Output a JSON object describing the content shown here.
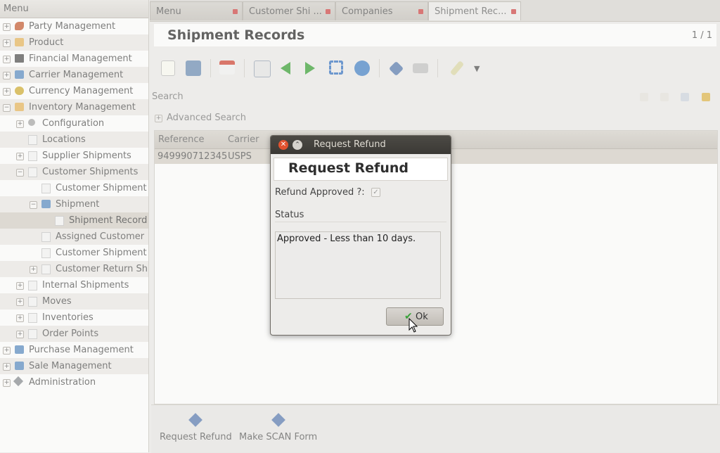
{
  "sidebar": {
    "header": "Menu",
    "items": [
      {
        "label": "Party Management",
        "expander": "+",
        "icon": "party-icon"
      },
      {
        "label": "Product",
        "expander": "+",
        "icon": "box-icon"
      },
      {
        "label": "Financial Management",
        "expander": "+",
        "icon": "calculator-icon"
      },
      {
        "label": "Carrier Management",
        "expander": "+",
        "icon": "folder-icon"
      },
      {
        "label": "Currency Management",
        "expander": "+",
        "icon": "coins-icon"
      },
      {
        "label": "Inventory Management",
        "expander": "−",
        "icon": "box-icon"
      },
      {
        "label": "Configuration",
        "expander": "+",
        "icon": "gear-icon"
      },
      {
        "label": "Locations",
        "expander": "",
        "icon": "document-icon"
      },
      {
        "label": "Supplier Shipments",
        "expander": "+",
        "icon": "document-icon"
      },
      {
        "label": "Customer Shipments",
        "expander": "−",
        "icon": "document-icon"
      },
      {
        "label": "Customer Shipment",
        "expander": "",
        "icon": "document-icon"
      },
      {
        "label": "Shipment",
        "expander": "−",
        "icon": "folder-icon"
      },
      {
        "label": "Shipment Record",
        "expander": "",
        "icon": "document-icon"
      },
      {
        "label": "Assigned Customer",
        "expander": "",
        "icon": "document-icon"
      },
      {
        "label": "Customer Shipment",
        "expander": "",
        "icon": "document-icon"
      },
      {
        "label": "Customer Return Sh",
        "expander": "+",
        "icon": "document-icon"
      },
      {
        "label": "Internal Shipments",
        "expander": "+",
        "icon": "document-icon"
      },
      {
        "label": "Moves",
        "expander": "+",
        "icon": "document-icon"
      },
      {
        "label": "Inventories",
        "expander": "+",
        "icon": "document-icon"
      },
      {
        "label": "Order Points",
        "expander": "+",
        "icon": "document-icon"
      },
      {
        "label": "Purchase Management",
        "expander": "+",
        "icon": "folder-icon"
      },
      {
        "label": "Sale Management",
        "expander": "+",
        "icon": "folder-icon"
      },
      {
        "label": "Administration",
        "expander": "+",
        "icon": "tools-icon"
      }
    ]
  },
  "tabs": [
    {
      "label": "Menu"
    },
    {
      "label": "Customer Shi ..."
    },
    {
      "label": "Companies"
    },
    {
      "label": "Shipment Rec..."
    }
  ],
  "main": {
    "title": "Shipment Records",
    "count": "1 / 1",
    "search_label": "Search",
    "advanced_search": "Advanced Search",
    "columns": [
      "Reference",
      "Carrier"
    ],
    "rows": [
      {
        "reference": "949990712345",
        "carrier": "USPS"
      }
    ]
  },
  "actions": [
    {
      "label": "Request Refund"
    },
    {
      "label": "Make SCAN Form"
    }
  ],
  "dialog": {
    "window_title": "Request Refund",
    "heading": "Request Refund",
    "refund_label": "Refund Approved ?:",
    "refund_checked": true,
    "status_label": "Status",
    "status_value": "Approved - Less than 10 days.",
    "ok_label": "Ok"
  },
  "colors": {
    "accent_green": "#3ea33a",
    "close_red": "#e2522f",
    "titlebar": "#3b3935"
  }
}
